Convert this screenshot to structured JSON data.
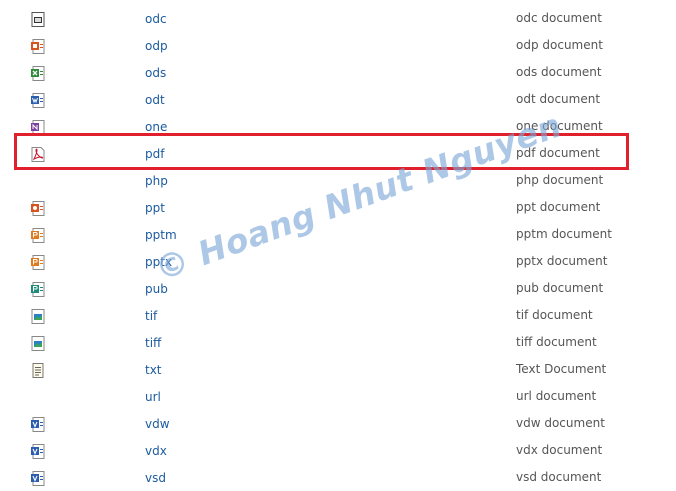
{
  "files": [
    {
      "ext": "odc",
      "desc": "odc document",
      "icon": "odc-file-icon"
    },
    {
      "ext": "odp",
      "desc": "odp document",
      "icon": "odp-file-icon"
    },
    {
      "ext": "ods",
      "desc": "ods document",
      "icon": "ods-file-icon"
    },
    {
      "ext": "odt",
      "desc": "odt document",
      "icon": "odt-file-icon"
    },
    {
      "ext": "one",
      "desc": "one document",
      "icon": "onenote-file-icon"
    },
    {
      "ext": "pdf",
      "desc": "pdf document",
      "icon": "pdf-file-icon"
    },
    {
      "ext": "php",
      "desc": "php document",
      "icon": ""
    },
    {
      "ext": "ppt",
      "desc": "ppt document",
      "icon": "ppt-file-icon"
    },
    {
      "ext": "pptm",
      "desc": "pptm document",
      "icon": "pptm-file-icon"
    },
    {
      "ext": "pptx",
      "desc": "pptx document",
      "icon": "pptx-file-icon"
    },
    {
      "ext": "pub",
      "desc": "pub document",
      "icon": "pub-file-icon"
    },
    {
      "ext": "tif",
      "desc": "tif document",
      "icon": "tif-image-icon"
    },
    {
      "ext": "tiff",
      "desc": "tiff document",
      "icon": "tiff-image-icon"
    },
    {
      "ext": "txt",
      "desc": "Text Document",
      "icon": "text-file-icon"
    },
    {
      "ext": "url",
      "desc": "url document",
      "icon": ""
    },
    {
      "ext": "vdw",
      "desc": "vdw document",
      "icon": "vdw-visio-icon"
    },
    {
      "ext": "vdx",
      "desc": "vdx document",
      "icon": "vdx-visio-icon"
    },
    {
      "ext": "vsd",
      "desc": "vsd document",
      "icon": "vsd-visio-icon"
    }
  ],
  "highlight": {
    "row": "pdf",
    "color": "#e0202c"
  },
  "watermark": {
    "text": "© Hoang Nhut Nguyen",
    "color": "#7aa6d6"
  },
  "colors": {
    "link": "#1a5a9e",
    "desc": "#555555"
  }
}
